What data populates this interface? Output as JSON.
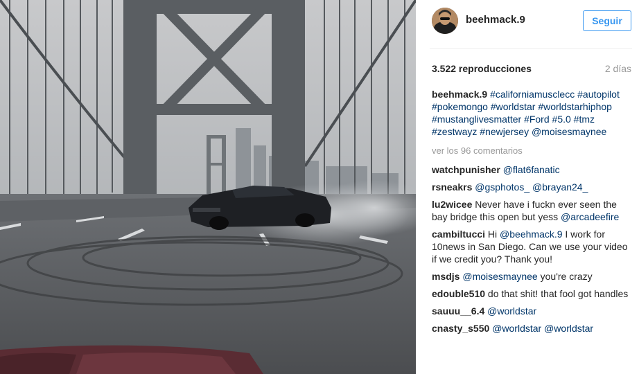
{
  "post": {
    "username": "beehmack.9",
    "follow_label": "Seguir",
    "views": "3.522 reproducciones",
    "time_ago": "2 días"
  },
  "caption": {
    "user": "beehmack.9",
    "tags": [
      "#californiamusclecc",
      "#autopilot",
      "#pokemongo",
      "#worldstar",
      "#worldstarhiphop",
      "#mustanglivesmatter",
      "#Ford",
      "#5.0",
      "#tmz",
      "#zestwayz",
      "#newjersey",
      "@moisesmaynee"
    ]
  },
  "view_all_comments": "ver los 96 comentarios",
  "comments": [
    {
      "user": "watchpunisher",
      "parts": [
        {
          "t": "mention",
          "v": "@flat6fanatic"
        }
      ]
    },
    {
      "user": "rsneakrs",
      "parts": [
        {
          "t": "mention",
          "v": "@gsphotos_"
        },
        {
          "t": "text",
          "v": " "
        },
        {
          "t": "mention",
          "v": "@brayan24_"
        }
      ]
    },
    {
      "user": "lu2wicee",
      "parts": [
        {
          "t": "text",
          "v": "Never have i fuckn ever seen the bay bridge this open but yess "
        },
        {
          "t": "mention",
          "v": "@arcadeefire"
        }
      ]
    },
    {
      "user": "cambiltucci",
      "parts": [
        {
          "t": "text",
          "v": "Hi "
        },
        {
          "t": "mention",
          "v": "@beehmack.9"
        },
        {
          "t": "text",
          "v": " I work for 10news in San Diego. Can we use your video if we credit you? Thank you!"
        }
      ]
    },
    {
      "user": "msdjs",
      "parts": [
        {
          "t": "mention",
          "v": "@moisesmaynee"
        },
        {
          "t": "text",
          "v": " you're crazy"
        }
      ]
    },
    {
      "user": "edouble510",
      "parts": [
        {
          "t": "text",
          "v": "do that shit! that fool got handles"
        }
      ]
    },
    {
      "user": "sauuu__6.4",
      "parts": [
        {
          "t": "mention",
          "v": "@worldstar"
        }
      ]
    },
    {
      "user": "cnasty_s550",
      "parts": [
        {
          "t": "mention",
          "v": "@worldstar"
        },
        {
          "t": "text",
          "v": " "
        },
        {
          "t": "mention",
          "v": "@worldstar"
        }
      ]
    }
  ],
  "colors": {
    "follow": "#3897f0",
    "tag": "#003569",
    "muted": "#999999"
  },
  "icons": {
    "avatar": "profile-photo"
  }
}
